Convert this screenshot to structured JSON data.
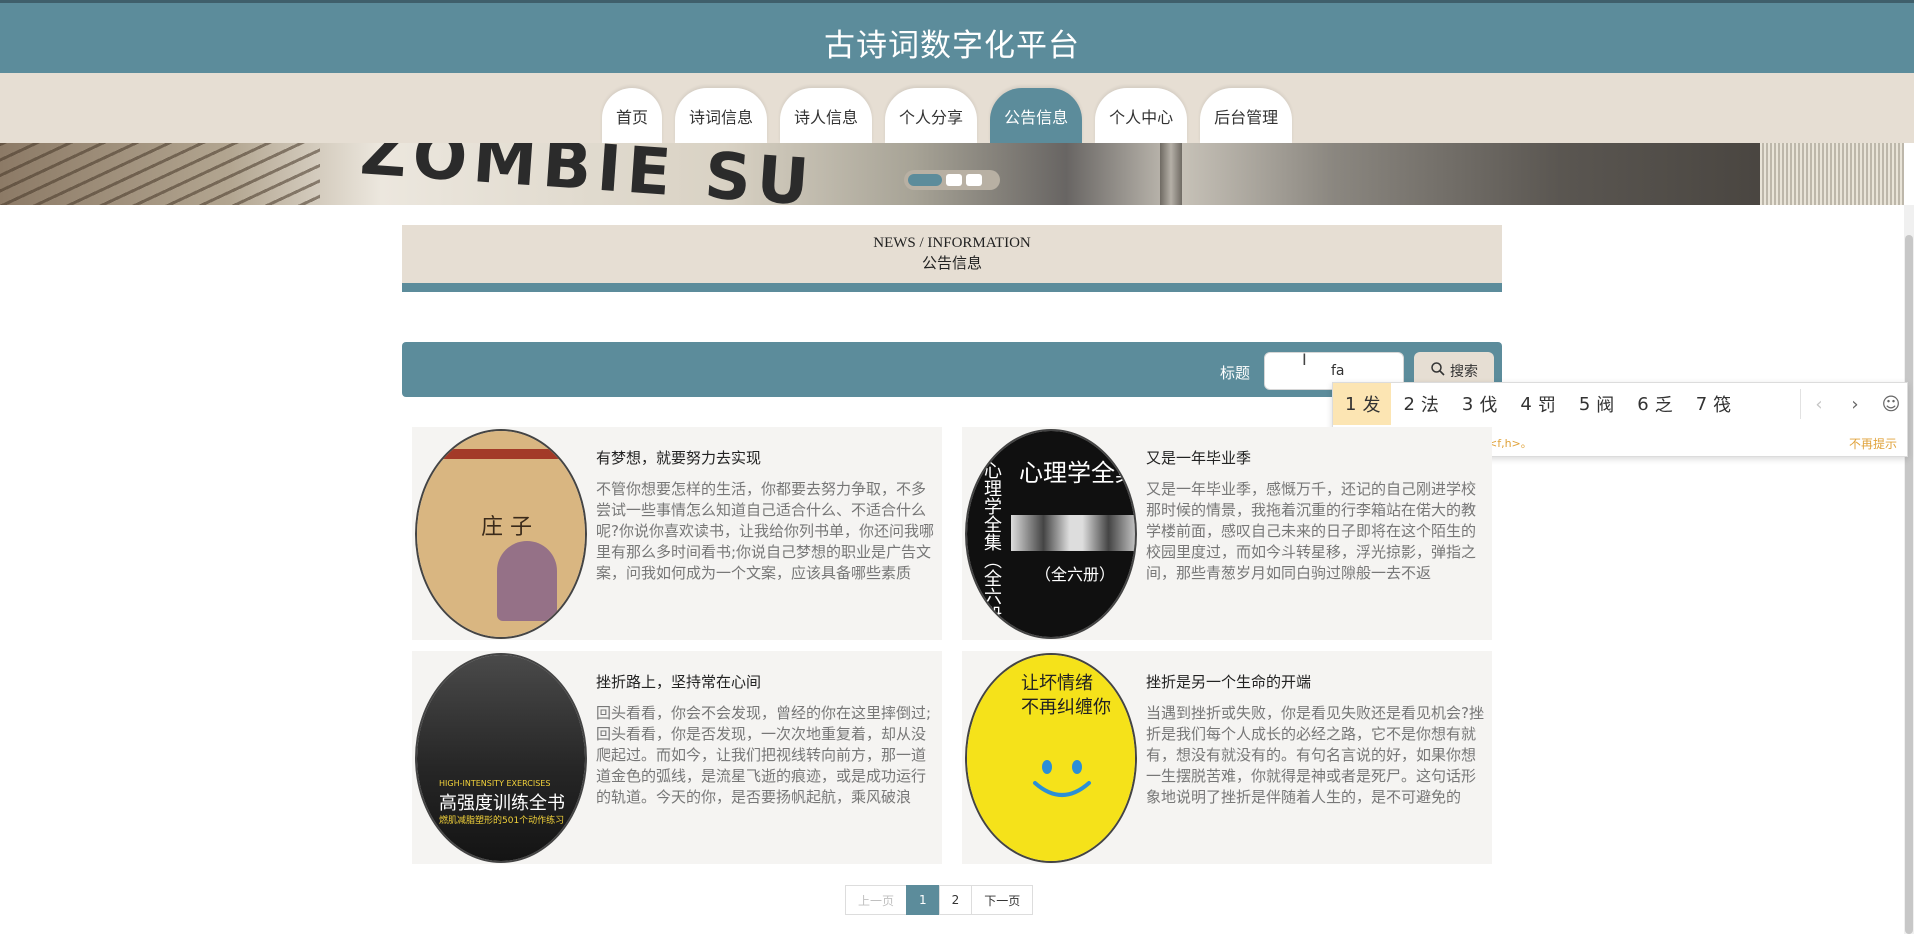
{
  "site": {
    "title": "古诗词数字化平台"
  },
  "nav": {
    "items": [
      {
        "label": "首页"
      },
      {
        "label": "诗词信息"
      },
      {
        "label": "诗人信息"
      },
      {
        "label": "个人分享"
      },
      {
        "label": "公告信息",
        "active": true
      },
      {
        "label": "个人中心"
      },
      {
        "label": "后台管理"
      }
    ]
  },
  "banner": {
    "text": "ZOMBIE SU",
    "active_slide": 1,
    "slide_count": 3
  },
  "section": {
    "title_en": "NEWS / INFORMATION",
    "title_cn": "公告信息"
  },
  "search": {
    "label": "标题",
    "value": "fa",
    "button_label": "搜索",
    "cursor_glyph": "I"
  },
  "ime": {
    "candidates": [
      {
        "n": "1",
        "char": "发"
      },
      {
        "n": "2",
        "char": "法"
      },
      {
        "n": "3",
        "char": "伐"
      },
      {
        "n": "4",
        "char": "罚"
      },
      {
        "n": "5",
        "char": "阀"
      },
      {
        "n": "6",
        "char": "乏"
      },
      {
        "n": "7",
        "char": "筏"
      }
    ],
    "prev": "‹",
    "next": "›",
    "emoji": "☺",
    "tip": "点击前往设置页面开启模糊音<f,h>。",
    "dismiss": "不再提示"
  },
  "cards": [
    {
      "title": "有梦想，就要努力去实现",
      "body": "不管你想要怎样的生活，你都要去努力争取，不多尝试一些事情怎么知道自己适合什么、不适合什么呢?你说你喜欢读书，让我给你列书单，你还问我哪里有那么多时间看书;你说自己梦想的职业是广告文案，问我如何成为一个文案，应该具备哪些素质",
      "cover": {
        "title": "庄 子"
      }
    },
    {
      "title": "又是一年毕业季",
      "body": "又是一年毕业季，感慨万千，还记的自己刚进学校那时候的情景，我拖着沉重的行李箱站在偌大的教学楼前面，感叹自己未来的日子即将在这个陌生的校园里度过，而如今斗转星移，浮光掠影，弹指之间，那些青葱岁月如同白驹过隙般一去不返",
      "cover": {
        "title": "心理学全集",
        "vertical": "心理学全集（全六册）",
        "subtitle": "（全六册）"
      }
    },
    {
      "title": "挫折路上，坚持常在心间",
      "body": "回头看看，你会不会发现，曾经的你在这里摔倒过;回头看看，你是否发现，一次次地重复着，却从没爬起过。而如今，让我们把视线转向前方，那一道道金色的弧线，是流星飞逝的痕迹，或是成功运行的轨道。今天的你，是否要扬帆起航，乘风破浪",
      "cover": {
        "en": "HIGH-INTENSITY EXERCISES",
        "title": "高强度训练全书",
        "subtitle": "燃肌减脂塑形的501个动作练习"
      }
    },
    {
      "title": "挫折是另一个生命的开端",
      "body": "当遇到挫折或失败，你是看见失败还是看见机会?挫折是我们每个人成长的必经之路，它不是你想有就有，想没有就没有的。有句名言说的好，如果你想一生摆脱苦难，你就得是神或者是死尸。这句话形象地说明了挫折是伴随着人生的，是不可避免的",
      "cover": {
        "title_1": "让坏情绪",
        "title_2": "不再纠缠你"
      }
    }
  ],
  "pagination": {
    "prev": "上一页",
    "pages": [
      "1",
      "2"
    ],
    "current": "1",
    "next": "下一页"
  }
}
